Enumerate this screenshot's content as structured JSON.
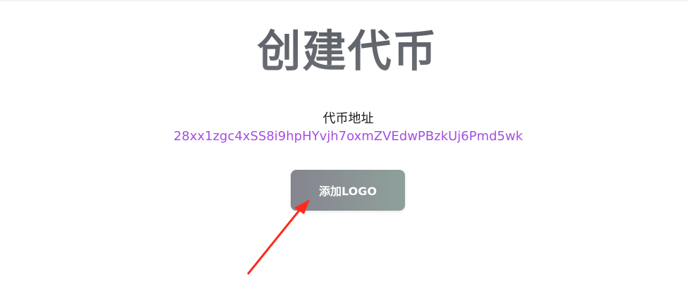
{
  "page": {
    "title": "创建代币"
  },
  "token": {
    "address_label": "代币地址",
    "address_value": "28xx1zgc4xSS8i9hpHYvjh7oxmZVEdwPBzkUj6Pmd5wk"
  },
  "actions": {
    "add_logo_label": "添加LOGO"
  },
  "colors": {
    "address_text": "#a64fe0",
    "button_gradient_start": "#85858f",
    "button_gradient_end": "#8fa19b",
    "annotation_arrow": "#ff2a1a"
  },
  "icons": {
    "annotation": "red-arrow-icon"
  }
}
